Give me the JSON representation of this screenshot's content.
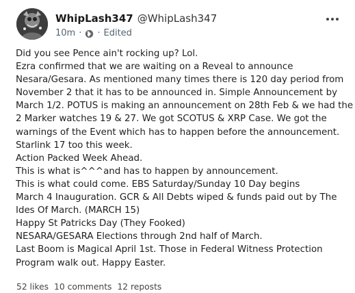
{
  "post": {
    "author": {
      "display_name": "WhipLash347",
      "handle": "@WhipLash347",
      "avatar_icon": "avatar-image"
    },
    "meta": {
      "time": "10m",
      "separator": "·",
      "audience_icon": "globe-icon",
      "edited": "Edited"
    },
    "more_icon": "more-horizontal-icon",
    "body_lines": [
      "Did you see Pence ain't rocking up? Lol.",
      "Ezra confirmed that we are waiting on a Reveal to announce",
      "Nesara/Gesara. As mentioned many times there is 120 day period from",
      "November 2 that it has to be announced in. Simple Announcement by",
      "March 1/2. POTUS is making an announcement on 28th Feb & we had the",
      "2 Marker watches 19 & 27. We got SCOTUS & XRP Case. We got the",
      "warnings of the Event which has to happen before the announcement.",
      "Starlink 17 too this week.",
      "Action Packed Week Ahead.",
      "This is what is^^^and has to happen by announcement.",
      "This is what could come. EBS Saturday/Sunday 10 Day begins",
      "March 4 Inauguration. GCR & All Debts wiped & funds paid out by The",
      "Ides Of March. (MARCH 15)",
      "Happy St Patricks Day (They Fooked)",
      "NESARA/GESARA Elections through 2nd half of March.",
      "Last Boom is Magical April 1st. Those in Federal Witness Protection",
      "Program walk out. Happy Easter."
    ],
    "stats": {
      "likes": "52 likes",
      "comments": "10 comments",
      "reposts": "12 reposts"
    }
  },
  "colors": {
    "text": "#1f1f1f",
    "meta": "#536471",
    "background": "#ffffff"
  }
}
